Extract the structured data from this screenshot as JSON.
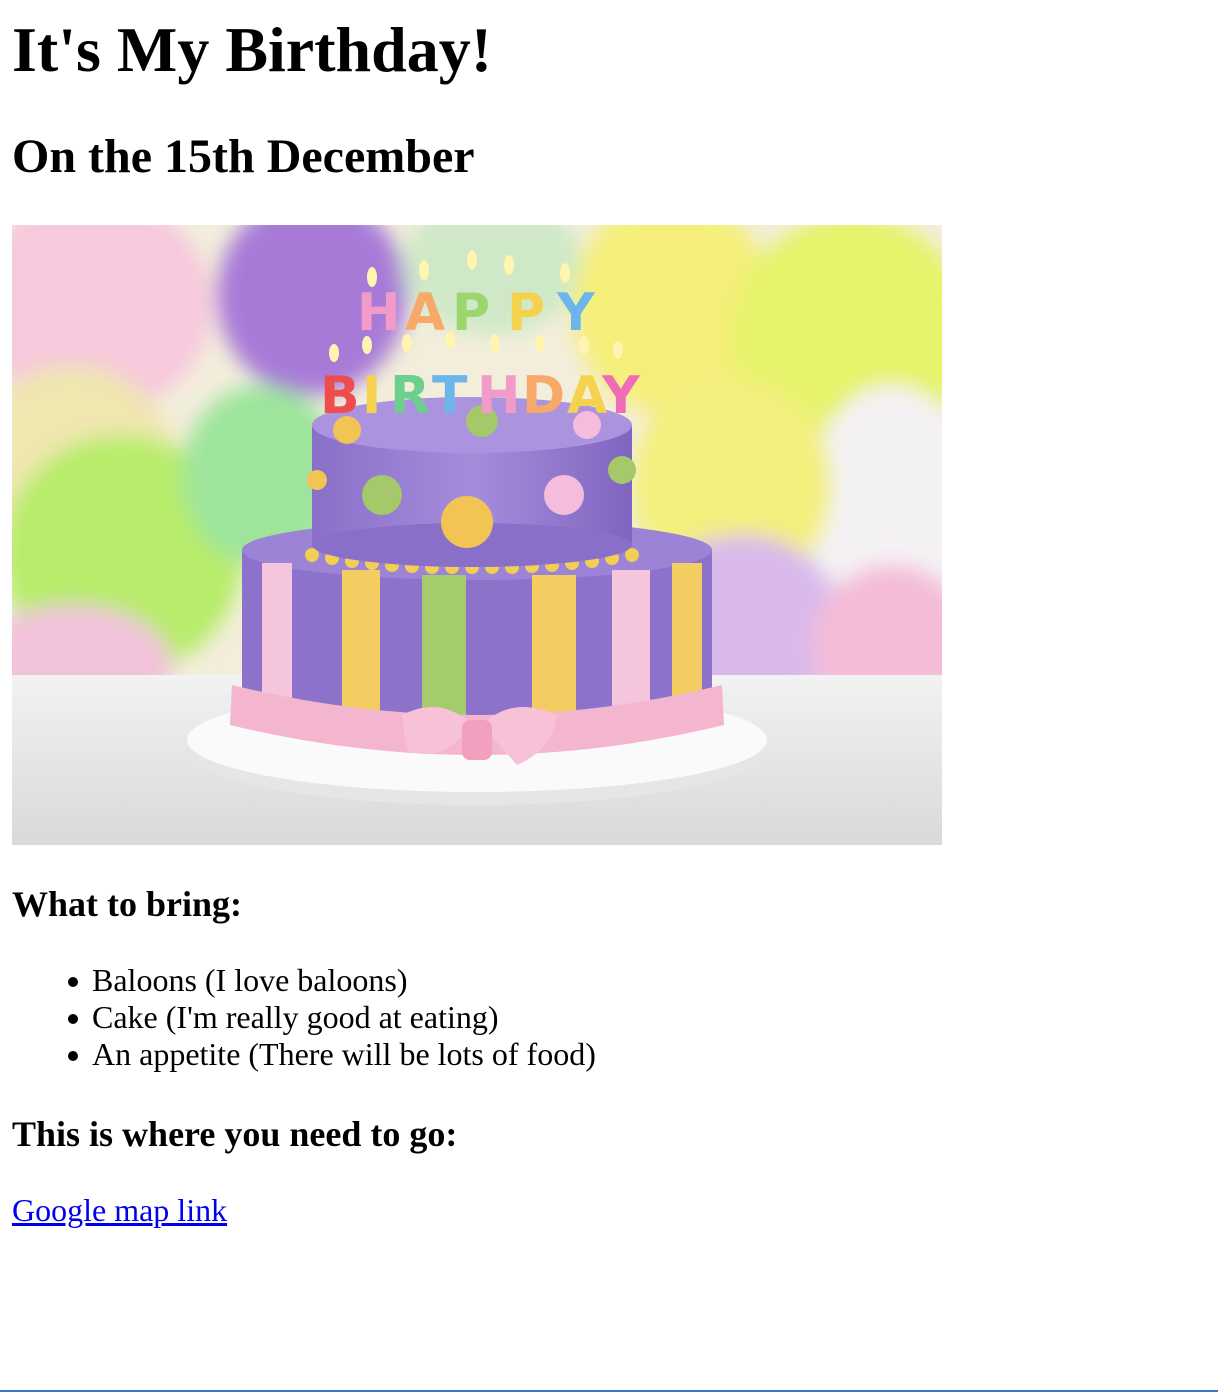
{
  "page": {
    "title": "It's My Birthday!",
    "subtitle": "On the 15th December"
  },
  "image": {
    "description_icon": "birthday-cake-photo"
  },
  "bring": {
    "heading": "What to bring:",
    "items": [
      "Baloons (I love baloons)",
      "Cake (I'm really good at eating)",
      "An appetite (There will be lots of food)"
    ]
  },
  "directions": {
    "heading": "This is where you need to go:",
    "link_text": "Google map link"
  },
  "colors": {
    "link": "#0000ee",
    "text": "#000000",
    "background": "#ffffff"
  }
}
